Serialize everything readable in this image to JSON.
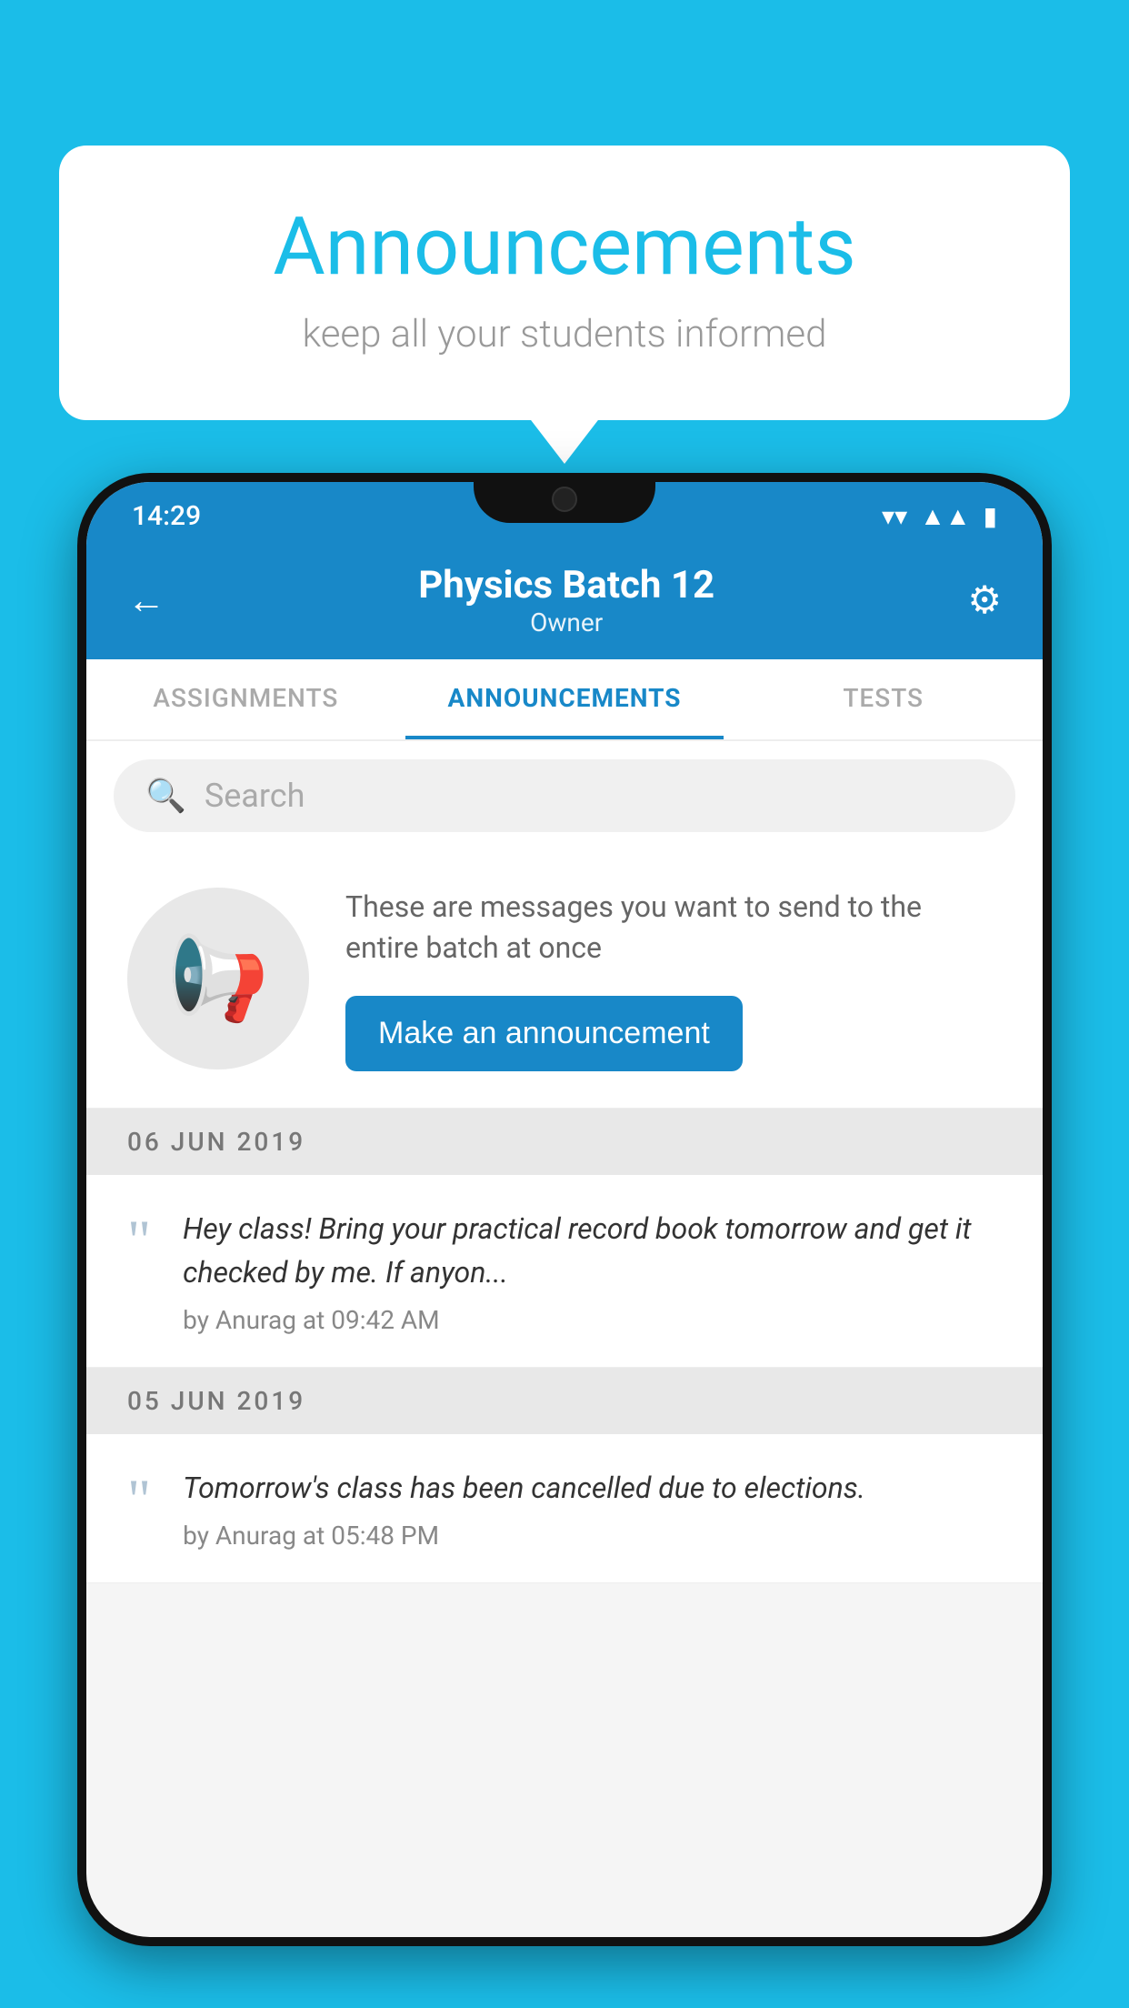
{
  "background_color": "#1BBDE8",
  "speech_bubble": {
    "title": "Announcements",
    "subtitle": "keep all your students informed"
  },
  "status_bar": {
    "time": "14:29",
    "wifi": "▾",
    "signal": "▲",
    "battery": "▮"
  },
  "header": {
    "title": "Physics Batch 12",
    "subtitle": "Owner",
    "back_label": "←",
    "settings_label": "⚙"
  },
  "tabs": [
    {
      "label": "ASSIGNMENTS",
      "active": false
    },
    {
      "label": "ANNOUNCEMENTS",
      "active": true
    },
    {
      "label": "TESTS",
      "active": false
    }
  ],
  "search": {
    "placeholder": "Search"
  },
  "announcement_cta": {
    "description": "These are messages you want to send to the entire batch at once",
    "button_label": "Make an announcement"
  },
  "date_sections": [
    {
      "date": "06  JUN  2019",
      "items": [
        {
          "text": "Hey class! Bring your practical record book tomorrow and get it checked by me. If anyon...",
          "meta": "by Anurag at 09:42 AM"
        }
      ]
    },
    {
      "date": "05  JUN  2019",
      "items": [
        {
          "text": "Tomorrow's class has been cancelled due to elections.",
          "meta": "by Anurag at 05:48 PM"
        }
      ]
    }
  ]
}
